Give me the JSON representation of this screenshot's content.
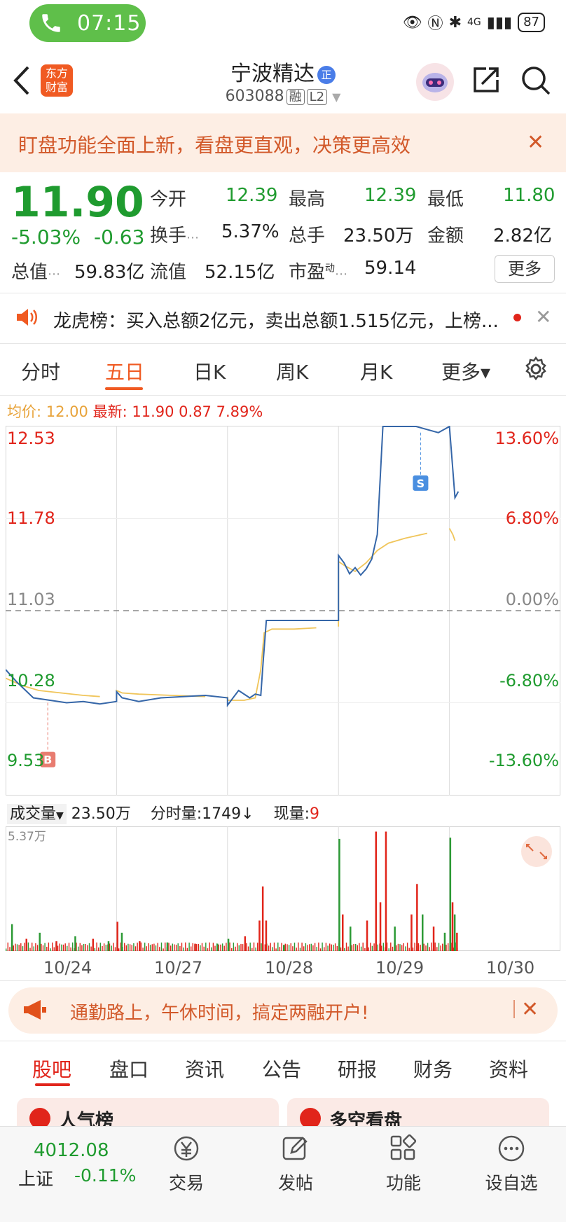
{
  "status_bar": {
    "time": "07:15",
    "signal": "4G",
    "battery": "87"
  },
  "header": {
    "brand_logo_text": "东方财富",
    "stock_name": "宁波精达",
    "badge": "正",
    "stock_code": "603088",
    "tag_rong": "融",
    "tag_level": "L2"
  },
  "promo_banner": {
    "text": "盯盘功能全面上新，看盘更直观，决策更高效",
    "close": "✕"
  },
  "quote": {
    "price": "11.90",
    "change_pct": "-5.03%",
    "change_abs": "-0.63",
    "today_open_label": "今开",
    "today_open": "12.39",
    "high_label": "最高",
    "high": "12.39",
    "low_label": "最低",
    "low": "11.80",
    "turnover_label": "换手",
    "turnover": "5.37%",
    "volume_label": "总手",
    "volume": "23.50万",
    "amount_label": "金额",
    "amount": "2.82亿",
    "mkt_cap_label": "总值",
    "mkt_cap": "59.83亿",
    "float_cap_label": "流值",
    "float_cap": "52.15亿",
    "pe_label": "市盈",
    "pe_sup": "动",
    "pe": "59.14",
    "more_label": "更多"
  },
  "dragon_tiger": {
    "text": "龙虎榜：买入总额2亿元，卖出总额1.515亿元，上榜...",
    "close": "✕"
  },
  "chart_tabs": [
    "分时",
    "五日",
    "日K",
    "周K",
    "月K",
    "更多▾"
  ],
  "chart_tabs_active": "五日",
  "avg_info": {
    "avg_label": "均价:",
    "avg_value": "12.00",
    "latest_label": "最新:",
    "latest_value": "11.90",
    "change": "0.87",
    "change_pct": "7.89%"
  },
  "chart_data": {
    "type": "line",
    "title": "",
    "y_left_ticks": [
      "12.53",
      "11.78",
      "11.03",
      "10.28",
      "9.53"
    ],
    "y_right_ticks": [
      "13.60%",
      "6.80%",
      "0.00%",
      "-6.80%",
      "-13.60%"
    ],
    "ylim": [
      9.53,
      12.53
    ],
    "x_dates": [
      "10/24",
      "10/27",
      "10/28",
      "10/29",
      "10/30"
    ],
    "series": [
      {
        "key": "price",
        "color": "#3566a8",
        "x": [
          0,
          0.1,
          0.25,
          0.4,
          0.55,
          0.7,
          0.85,
          1.0,
          1.0,
          1.05,
          1.2,
          1.4,
          1.6,
          1.8,
          2.0,
          2.0,
          2.1,
          2.2,
          2.25,
          2.3,
          2.32,
          2.35,
          2.5,
          2.7,
          3.0,
          3.0,
          3.05,
          3.1,
          3.15,
          3.2,
          3.25,
          3.3,
          3.35,
          3.4,
          3.5,
          3.7,
          3.9,
          4.0,
          4.0,
          4.03,
          4.05,
          4.08
        ],
        "y": [
          10.55,
          10.45,
          10.32,
          10.3,
          10.28,
          10.29,
          10.27,
          10.29,
          10.37,
          10.32,
          10.29,
          10.32,
          10.33,
          10.34,
          10.32,
          10.26,
          10.38,
          10.32,
          10.35,
          10.34,
          10.6,
          10.95,
          10.95,
          10.95,
          10.95,
          11.48,
          11.42,
          11.33,
          11.38,
          11.32,
          11.37,
          11.45,
          11.65,
          12.53,
          12.53,
          12.53,
          12.48,
          12.53,
          12.53,
          12.18,
          11.95,
          12.0
        ]
      },
      {
        "key": "average",
        "color": "#f0c55a",
        "x": [
          0,
          0.15,
          0.3,
          0.5,
          0.7,
          0.85,
          1.0,
          1.0,
          1.05,
          1.2,
          1.5,
          1.8,
          2.0,
          2.0,
          2.15,
          2.25,
          2.3,
          2.33,
          2.4,
          2.6,
          2.8,
          3.0,
          3.0,
          3.05,
          3.15,
          3.25,
          3.35,
          3.45,
          3.6,
          3.8,
          4.0,
          4.0,
          4.03,
          4.05
        ],
        "y": [
          10.48,
          10.42,
          10.38,
          10.36,
          10.34,
          10.33,
          10.33,
          10.38,
          10.36,
          10.35,
          10.34,
          10.33,
          10.33,
          10.3,
          10.3,
          10.32,
          10.55,
          10.85,
          10.88,
          10.88,
          10.89,
          10.9,
          11.43,
          11.4,
          11.35,
          11.42,
          11.52,
          11.58,
          11.62,
          11.66,
          11.7,
          11.7,
          11.65,
          11.6
        ]
      }
    ],
    "markers": [
      {
        "label": "B",
        "color": "#e87c70"
      },
      {
        "label": "S",
        "color": "#4a8fe0"
      }
    ],
    "prev_close": 11.03,
    "volume": {
      "label": "成交量",
      "total": "23.50万",
      "minute_label": "分时量:1749",
      "minute_arrow": "↓",
      "current_label": "现量:",
      "current_value": "9",
      "max_label": "5.37万",
      "spikes": [
        {
          "x": 0.05,
          "h": 0.22,
          "c": "#2c9a35"
        },
        {
          "x": 0.18,
          "h": 0.1,
          "c": "#e1251b"
        },
        {
          "x": 0.3,
          "h": 0.15,
          "c": "#2c9a35"
        },
        {
          "x": 0.45,
          "h": 0.08,
          "c": "#e1251b"
        },
        {
          "x": 0.62,
          "h": 0.12,
          "c": "#2c9a35"
        },
        {
          "x": 0.78,
          "h": 0.1,
          "c": "#e1251b"
        },
        {
          "x": 0.92,
          "h": 0.08,
          "c": "#2c9a35"
        },
        {
          "x": 1.0,
          "h": 0.24,
          "c": "#e1251b"
        },
        {
          "x": 1.04,
          "h": 0.15,
          "c": "#2c9a35"
        },
        {
          "x": 1.2,
          "h": 0.08,
          "c": "#e1251b"
        },
        {
          "x": 1.45,
          "h": 0.07,
          "c": "#2c9a35"
        },
        {
          "x": 1.7,
          "h": 0.06,
          "c": "#e1251b"
        },
        {
          "x": 1.9,
          "h": 0.06,
          "c": "#2c9a35"
        },
        {
          "x": 2.0,
          "h": 0.1,
          "c": "#2c9a35"
        },
        {
          "x": 2.15,
          "h": 0.12,
          "c": "#e1251b"
        },
        {
          "x": 2.28,
          "h": 0.25,
          "c": "#e1251b"
        },
        {
          "x": 2.31,
          "h": 0.53,
          "c": "#e1251b"
        },
        {
          "x": 2.34,
          "h": 0.25,
          "c": "#e1251b"
        },
        {
          "x": 2.5,
          "h": 0.05,
          "c": "#2c9a35"
        },
        {
          "x": 3.0,
          "h": 0.92,
          "c": "#2c9a35"
        },
        {
          "x": 3.03,
          "h": 0.3,
          "c": "#e1251b"
        },
        {
          "x": 3.1,
          "h": 0.2,
          "c": "#2c9a35"
        },
        {
          "x": 3.25,
          "h": 0.25,
          "c": "#e1251b"
        },
        {
          "x": 3.33,
          "h": 0.98,
          "c": "#e1251b"
        },
        {
          "x": 3.37,
          "h": 0.4,
          "c": "#e1251b"
        },
        {
          "x": 3.42,
          "h": 0.98,
          "c": "#e1251b"
        },
        {
          "x": 3.5,
          "h": 0.2,
          "c": "#2c9a35"
        },
        {
          "x": 3.65,
          "h": 0.3,
          "c": "#e1251b"
        },
        {
          "x": 3.7,
          "h": 0.55,
          "c": "#e1251b"
        },
        {
          "x": 3.75,
          "h": 0.3,
          "c": "#2c9a35"
        },
        {
          "x": 3.85,
          "h": 0.2,
          "c": "#e1251b"
        },
        {
          "x": 3.95,
          "h": 0.15,
          "c": "#2c9a35"
        },
        {
          "x": 4.0,
          "h": 0.93,
          "c": "#2c9a35"
        },
        {
          "x": 4.02,
          "h": 0.4,
          "c": "#e1251b"
        },
        {
          "x": 4.04,
          "h": 0.3,
          "c": "#2c9a35"
        },
        {
          "x": 4.06,
          "h": 0.15,
          "c": "#e1251b"
        }
      ]
    }
  },
  "ad_banner": {
    "text": "通勤路上，午休时间，搞定两融开户!",
    "close": "✕"
  },
  "bottom_tabs": [
    "股吧",
    "盘口",
    "资讯",
    "公告",
    "研报",
    "财务",
    "资料"
  ],
  "cards": [
    "人气榜",
    "多空看盘"
  ],
  "bottom_nav": {
    "index_value": "4012.08",
    "index_name": "上证",
    "index_change": "-0.11%",
    "items": [
      "交易",
      "发帖",
      "功能",
      "设自选"
    ]
  }
}
